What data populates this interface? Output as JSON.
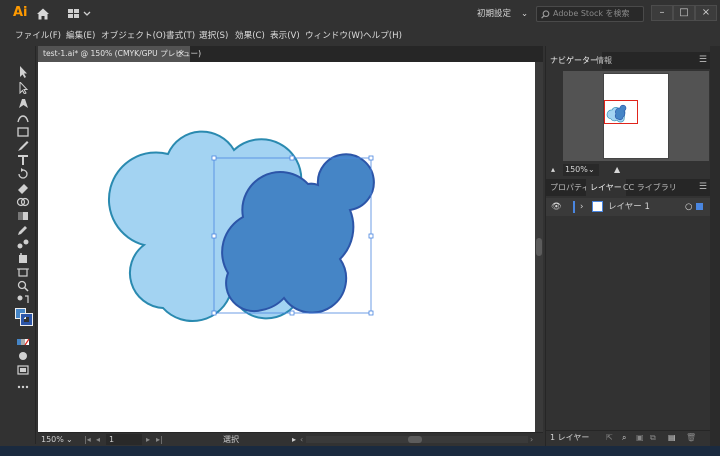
{
  "titlebar": {
    "app_logo": "Ai",
    "workspace_label": "初期設定",
    "stock_search_placeholder": "Adobe Stock を検索",
    "icons": [
      "home-icon",
      "workspace-switcher-icon",
      "search-icon",
      "minimize-icon",
      "maximize-icon",
      "close-icon"
    ]
  },
  "menu": {
    "items": [
      "ファイル(F)",
      "編集(E)",
      "オブジェクト(O)",
      "書式(T)",
      "選択(S)",
      "効果(C)",
      "表示(V)",
      "ウィンドウ(W)",
      "ヘルプ(H)"
    ]
  },
  "document": {
    "tab_title": "test-1.ai* @ 150% (CMYK/GPU プレビュー)",
    "close_glyph": "×"
  },
  "status": {
    "zoom": "150%",
    "artboard": "1",
    "current_tool": "選択"
  },
  "navigator": {
    "tabs": [
      "ナビゲーター",
      "情報"
    ],
    "zoom": "150%"
  },
  "layers": {
    "tabs": [
      "プロパティ",
      "レイヤー",
      "CC ライブラリ"
    ],
    "layer_name": "レイヤー 1",
    "footer_count": "1 レイヤー"
  },
  "colors": {
    "app_accent": "#ff9a00",
    "shape_light_fill": "#a3d3f2",
    "shape_light_stroke": "#2a8ab0",
    "shape_dark_fill": "#4585c6",
    "shape_dark_stroke": "#2c55a8",
    "selection": "#4a86e0",
    "nav_proxy": "#e0241b"
  }
}
